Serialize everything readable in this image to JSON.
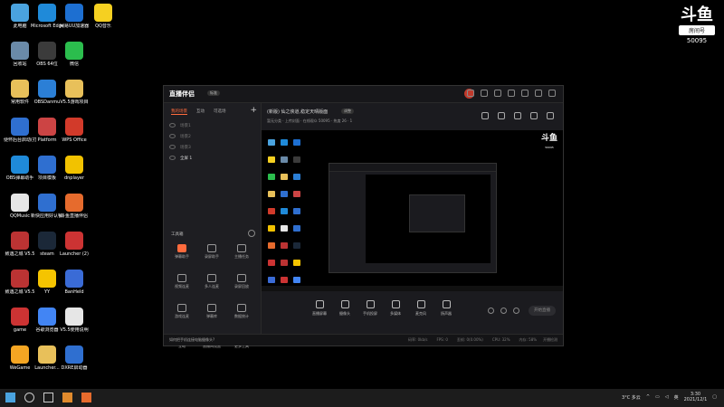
{
  "desktop": {
    "icons": [
      {
        "label": "此电脑",
        "color": "#4aa3df"
      },
      {
        "label": "Microsoft Edge",
        "color": "#1f8ad9"
      },
      {
        "label": "网易UU加速器",
        "color": "#1d6fd1"
      },
      {
        "label": "QQ音乐",
        "color": "#f5d021"
      },
      {
        "label": "回收站",
        "color": "#6a8aa8"
      },
      {
        "label": "OBS 64位",
        "color": "#3b3b3b"
      },
      {
        "label": "微信",
        "color": "#2bbd4d"
      },
      {
        "label": "常用软件",
        "color": "#e8c05a"
      },
      {
        "label": "OBSDanmu",
        "color": "#2b7fd6"
      },
      {
        "label": "V5.5游戏项目",
        "color": "#e8c05a"
      },
      {
        "label": "便怀后台启动(打开)",
        "color": "#2f6fd0"
      },
      {
        "label": "Platform",
        "color": "#c44"
      },
      {
        "label": "WPS Office",
        "color": "#d23a2a"
      },
      {
        "label": "OBS弹幕助手",
        "color": "#1f8ad9"
      },
      {
        "label": "项目模板",
        "color": "#2f6fd0"
      },
      {
        "label": "dnplayer",
        "color": "#f2c200"
      },
      {
        "label": "QQMusic",
        "color": "#e6e6e6"
      },
      {
        "label": "新快应用好认餐厅版(1)",
        "color": "#2f6fd0"
      },
      {
        "label": "斗鱼直播伴侣",
        "color": "#e66b2d"
      },
      {
        "label": "致遇之城 V5.5",
        "color": "#b33"
      },
      {
        "label": "steam",
        "color": "#1b2838"
      },
      {
        "label": "Launcher (2)",
        "color": "#c33"
      },
      {
        "label": "致遇之城 V5.5",
        "color": "#b33"
      },
      {
        "label": "YY",
        "color": "#f5c400"
      },
      {
        "label": "BanHeld",
        "color": "#3a6bd6"
      },
      {
        "label": "game",
        "color": "#c33"
      },
      {
        "label": "谷歌浏览器",
        "color": "#4285f4"
      },
      {
        "label": "V5.5使用说明",
        "color": "#e6e6e6"
      },
      {
        "label": "WeGame",
        "color": "#f5a623"
      },
      {
        "label": "Launcher...",
        "color": "#e8c05a"
      },
      {
        "label": "DXRE启动器",
        "color": "#2f6fd0"
      }
    ]
  },
  "brand": {
    "mark": "斗鱼",
    "room_label": "房间号",
    "room_number": "50095"
  },
  "app": {
    "name": "直播伴侣",
    "version": "标准",
    "sidebar": {
      "tabs": [
        "我的场景",
        "互动",
        "可选场"
      ],
      "scenes": [
        "场景1",
        "场景2",
        "场景3",
        "全屏 1"
      ],
      "tools_title": "工具箱",
      "tools": [
        "弹幕助手",
        "录屏助手",
        "主播任务",
        "视频连麦",
        "多人连麦",
        "录屏回放",
        "游戏连麦",
        "弹幕库",
        "数据统计",
        "互动",
        "直播间设置",
        "更多工具"
      ]
    },
    "room": {
      "title": "(新版) 仙之侠道,稳定天晴版面",
      "tag": "调整",
      "sub": "暂无分类   · 上传封面   · 在线观众  50095   · 热度 26   · 1"
    },
    "bottom_tools": [
      "直播屏幕",
      "摄像头",
      "手机投屏",
      "多媒体",
      "麦克风",
      "扬声器"
    ],
    "start_live": "开始直播",
    "status": {
      "tip": "如何把手机连接电脑摄像头?",
      "stats": [
        "码率: 0kb/s",
        "FPS: 0",
        "丢帧: 0(0.00%)",
        "CPU: 32%",
        "内存: 58%"
      ],
      "right": "开播检测"
    }
  },
  "taskbar": {
    "weather": "3°C 多云",
    "time": "3:30",
    "date": "2021/12/1"
  }
}
